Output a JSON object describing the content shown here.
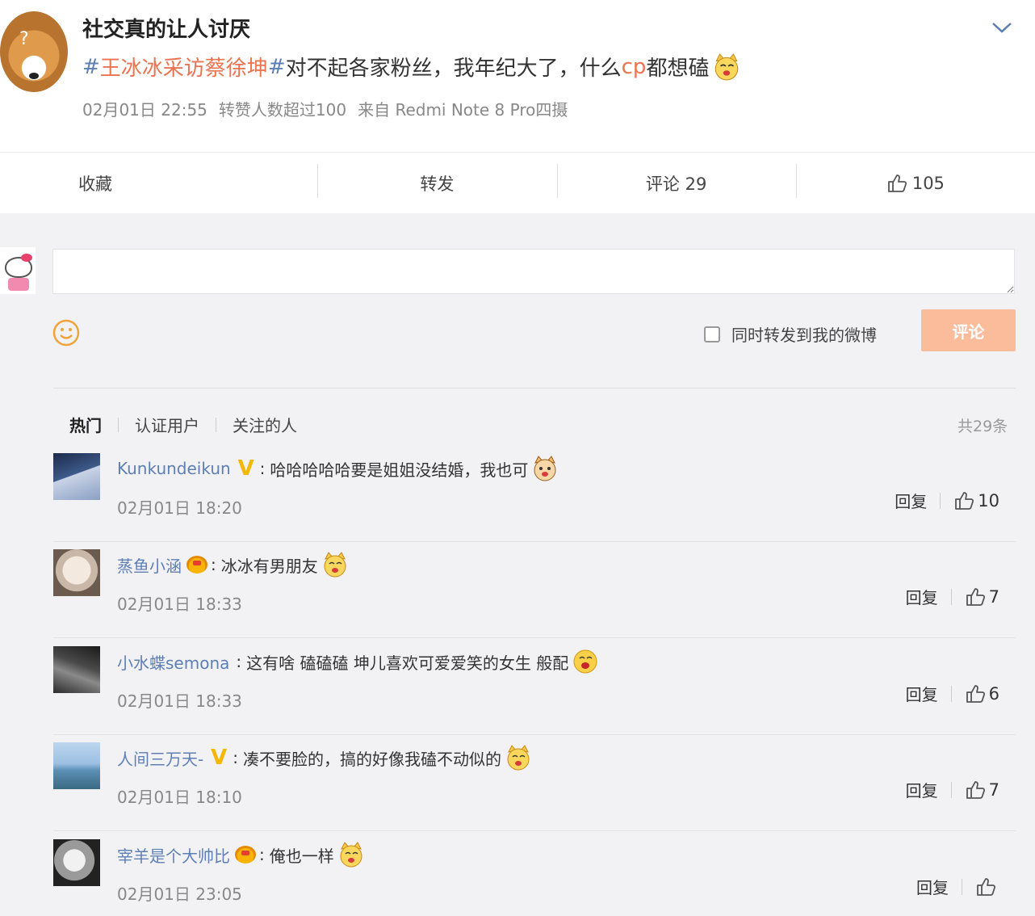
{
  "post": {
    "author": "社交真的让人讨厌",
    "avatar_mark": "?",
    "hash_open": "#",
    "topic": "王冰冰采访蔡徐坤",
    "hash_close": "#",
    "text_before": "对不起各家粉丝，我年纪大了，什么",
    "text_cp": "cp",
    "text_after": "都想磕",
    "time": "02月01日 22:55",
    "repost_note": "转赞人数超过100",
    "source": "来自 Redmi Note 8 Pro四摄"
  },
  "actions": {
    "favorite": "收藏",
    "repost": "转发",
    "comment": "评论 29",
    "likes": "105"
  },
  "composer": {
    "placeholder": "",
    "sync_label": "同时转发到我的微博",
    "submit_label": "评论"
  },
  "filters": {
    "tabs": [
      "热门",
      "认证用户",
      "关注的人"
    ],
    "total": "共29条"
  },
  "comments": [
    {
      "name": "Kunkundeikun",
      "badge": "v",
      "text": "哈哈哈哈哈要是姐姐没结婚，我也可",
      "emoji": "cat-emoji",
      "time": "02月01日 18:20",
      "reply": "回复",
      "likes": "10"
    },
    {
      "name": "蒸鱼小涵",
      "badge": "crown",
      "text": "冰冰有男朋友",
      "emoji": "cat-emoji",
      "time": "02月01日 18:33",
      "reply": "回复",
      "likes": "7"
    },
    {
      "name": "小水蝶semona",
      "badge": "none",
      "text": "这有啥 磕磕磕 坤儿喜欢可爱爱笑的女生 般配",
      "emoji": "kiss-emoji",
      "time": "02月01日 18:33",
      "reply": "回复",
      "likes": "6"
    },
    {
      "name": "人间三万天-",
      "badge": "v",
      "text": "凑不要脸的，搞的好像我磕不动似的",
      "emoji": "cat-emoji",
      "time": "02月01日 18:10",
      "reply": "回复",
      "likes": "7"
    },
    {
      "name": "宰羊是个大帅比",
      "badge": "crown",
      "text": "俺也一样",
      "emoji": "cat-emoji",
      "time": "02月01日 23:05",
      "reply": "回复",
      "likes": ""
    }
  ],
  "colors": {
    "link": "#5d7fb5",
    "topic": "#eb7350",
    "submit": "#fbbc9b",
    "badge_v": "#f5b800"
  }
}
